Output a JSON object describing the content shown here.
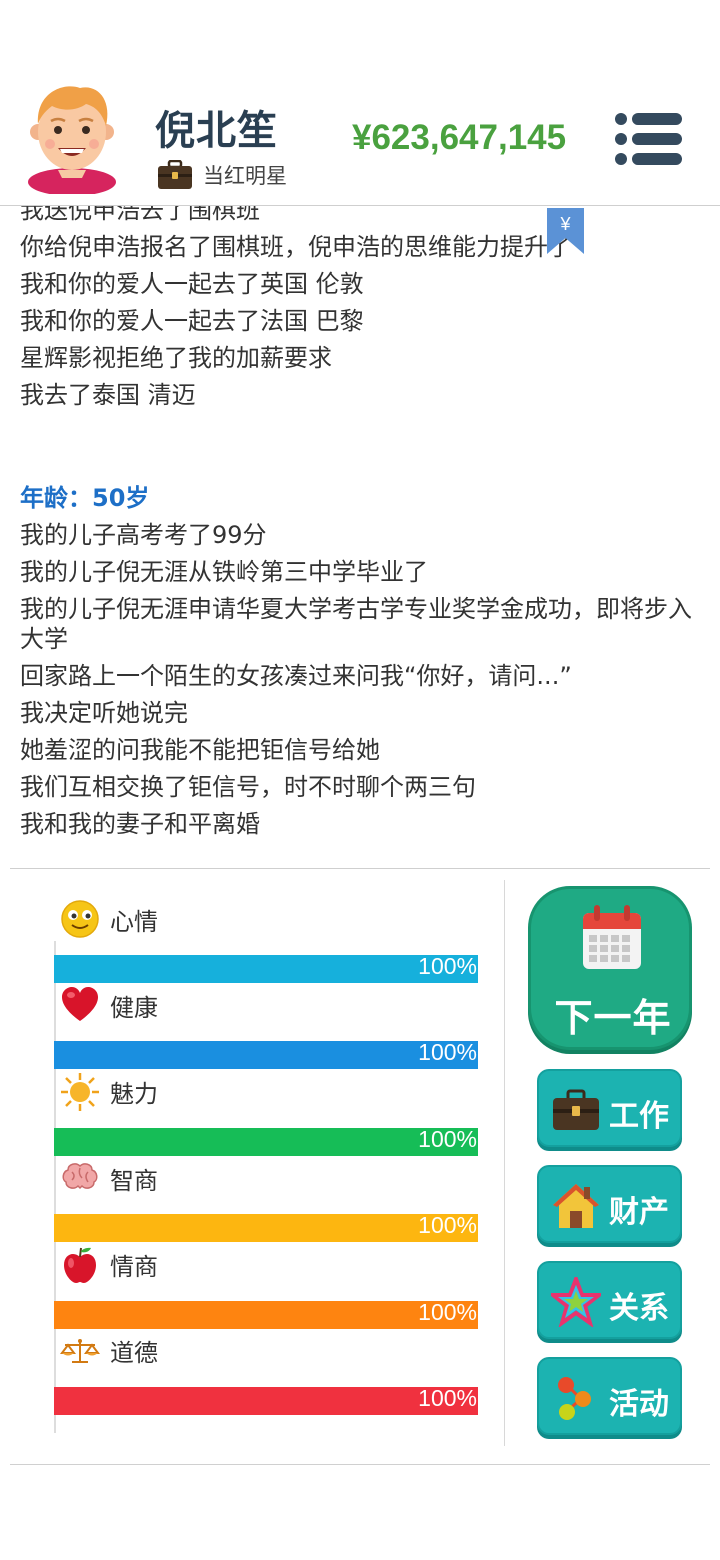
{
  "player": {
    "name": "倪北笙",
    "job": "当红明星",
    "money": "¥623,647,145"
  },
  "icons": {
    "avatar": "avatar-boy",
    "job": "briefcase-icon",
    "menu": "menu-icon",
    "bookmark": "yen-bookmark-icon"
  },
  "bookmark_label": "¥",
  "log": {
    "previous": [
      "我送倪申浩去了围棋班",
      "你给倪申浩报名了围棋班，倪申浩的思维能力提升了",
      "我和你的爱人一起去了英国 伦敦",
      "我和你的爱人一起去了法国 巴黎",
      "星辉影视拒绝了我的加薪要求",
      "我去了泰国 清迈"
    ],
    "age_heading": "年龄：50岁",
    "current": [
      "我的儿子高考考了99分",
      "我的儿子倪无涯从铁岭第三中学毕业了",
      "我的儿子倪无涯申请华夏大学考古学专业奖学金成功，即将步入大学",
      "回家路上一个陌生的女孩凑过来问我“你好，请问...”",
      "我决定听她说完",
      "她羞涩的问我能不能把钜信号给她",
      "我们互相交换了钜信号，时不时聊个两三句",
      "我和我的妻子和平离婚"
    ]
  },
  "stats": [
    {
      "label": "心情",
      "value_text": "100%",
      "value": 1.0,
      "color": "#16b0dc",
      "icon": "smiley-icon"
    },
    {
      "label": "健康",
      "value_text": "100%",
      "value": 1.0,
      "color": "#1a8fe0",
      "icon": "heart-icon"
    },
    {
      "label": "魅力",
      "value_text": "100%",
      "value": 1.0,
      "color": "#16bd57",
      "icon": "sun-icon"
    },
    {
      "label": "智商",
      "value_text": "100%",
      "value": 1.0,
      "color": "#fdb610",
      "icon": "brain-icon"
    },
    {
      "label": "情商",
      "value_text": "100%",
      "value": 1.0,
      "color": "#fe8410",
      "icon": "apple-icon"
    },
    {
      "label": "道德",
      "value_text": "100%",
      "value": 1.0,
      "color": "#f0313f",
      "icon": "scales-icon"
    }
  ],
  "actions": {
    "next_year": {
      "label": "下一年",
      "icon": "calendar-icon"
    },
    "work": {
      "label": "工作",
      "icon": "briefcase-icon"
    },
    "property": {
      "label": "财产",
      "icon": "house-icon"
    },
    "relations": {
      "label": "关系",
      "icon": "star-icon"
    },
    "activities": {
      "label": "活动",
      "icon": "dots-icon"
    }
  }
}
